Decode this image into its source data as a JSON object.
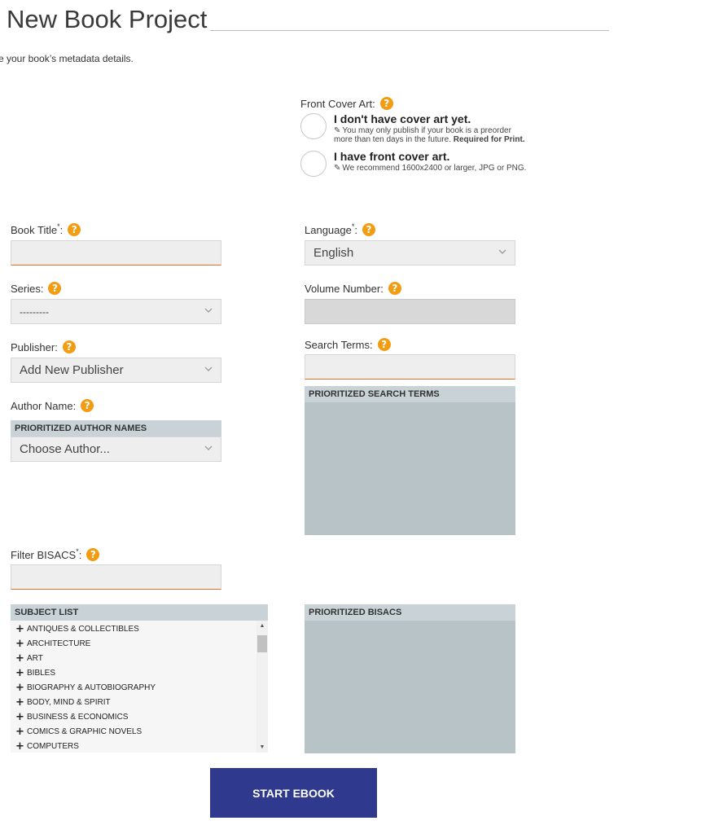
{
  "page": {
    "title": "New Book Project",
    "intro": "e your book’s metadata details."
  },
  "cover": {
    "label": "Front Cover Art:",
    "options": [
      {
        "title": "I don't have cover art yet.",
        "note_line1": "You may only publish if your book is a preorder",
        "note_line2": "more than ten days in the future.",
        "note_bold": "Required for Print."
      },
      {
        "title": "I have front cover art.",
        "note_line1": "We recommend 1600x2400 or larger, JPG or PNG."
      }
    ]
  },
  "form": {
    "book_title_label": "Book Title",
    "language_label": "Language",
    "language_value": "English",
    "series_label": "Series:",
    "series_value": "---------",
    "volume_label": "Volume Number:",
    "publisher_label": "Publisher:",
    "publisher_value": "Add New Publisher",
    "search_terms_label": "Search Terms:",
    "author_label": "Author Name:",
    "author_panel_head": "PRIORITIZED AUTHOR NAMES",
    "author_value": "Choose Author...",
    "search_panel_head": "PRIORITIZED SEARCH TERMS",
    "filter_bisacs_label": "Filter BISACS",
    "subject_list_head": "SUBJECT LIST",
    "prioritized_bisacs_head": "PRIORITIZED BISACS",
    "required_mark": "*",
    "colon": ":",
    "help_glyph": "?"
  },
  "subjects": [
    "ANTIQUES & COLLECTIBLES",
    "ARCHITECTURE",
    "ART",
    "BIBLES",
    "BIOGRAPHY & AUTOBIOGRAPHY",
    "BODY, MIND & SPIRIT",
    "BUSINESS & ECONOMICS",
    "COMICS & GRAPHIC NOVELS",
    "COMPUTERS"
  ],
  "actions": {
    "start_label": "START EBOOK"
  },
  "colors": {
    "accent": "#f39c12",
    "button": "#2f3a8f",
    "input_underline": "#e8702a",
    "panel": "#b8c3c8"
  },
  "icons": {
    "help": "help-icon",
    "edit": "edit-icon",
    "chevron": "chevron-down-icon",
    "plus": "plus-icon"
  }
}
